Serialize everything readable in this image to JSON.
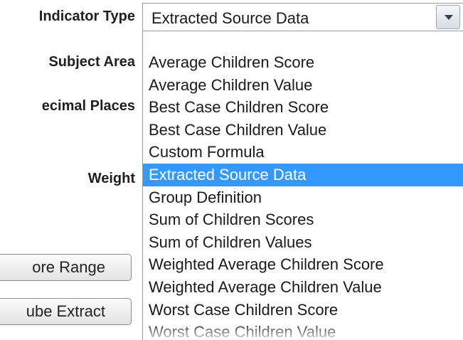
{
  "form": {
    "indicator_type_label": "Indicator Type",
    "subject_area_label": "Subject Area",
    "decimal_places_label": "ecimal Places",
    "weight_label": "Weight"
  },
  "buttons": {
    "range_label": "ore Range",
    "extract_label": "ube Extract"
  },
  "combo": {
    "selected_value": "Extracted Source Data",
    "arrow_icon": "chevron-down-icon"
  },
  "dropdown": {
    "selected_index": 5,
    "selected_color": "#3399ff",
    "items": [
      "Average Children Score",
      "Average Children Value",
      "Best Case Children Score",
      "Best Case Children Value",
      "Custom Formula",
      "Extracted Source Data",
      "Group Definition",
      "Sum of Children Scores",
      "Sum of Children Values",
      "Weighted Average Children Score",
      "Weighted Average Children Value",
      "Worst Case Children Score",
      "Worst Case Children Value"
    ]
  }
}
